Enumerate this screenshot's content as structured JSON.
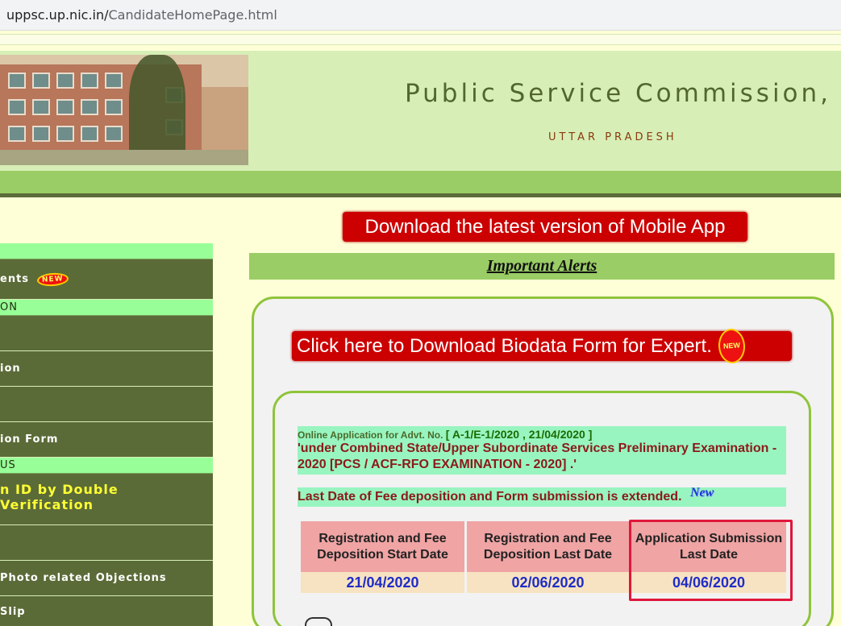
{
  "browser": {
    "url_host": "uppsc.up.nic.in/",
    "url_path": "CandidateHomePage.html"
  },
  "header": {
    "title": "Public Service Commission,",
    "subtitle": "UTTAR PRADESH"
  },
  "nav": {
    "items": [
      {
        "type": "header",
        "label": ""
      },
      {
        "type": "item",
        "label": "ents",
        "badge": "NEW"
      },
      {
        "type": "header",
        "label": "ON"
      },
      {
        "type": "item",
        "label": ""
      },
      {
        "type": "item",
        "label": "ion"
      },
      {
        "type": "item",
        "label": ""
      },
      {
        "type": "item",
        "label": "ion Form"
      },
      {
        "type": "header",
        "label": "US"
      },
      {
        "type": "item",
        "label": "n ID by Double Verification",
        "highlight": true
      },
      {
        "type": "item",
        "label": ""
      },
      {
        "type": "item",
        "label": "Photo related Objections"
      },
      {
        "type": "item",
        "label": "Slip"
      }
    ]
  },
  "banners": {
    "mobile_app": "Download the latest version of Mobile App",
    "important_alerts": "Important Alerts",
    "biodata": "Click here to Download Biodata Form for Expert.",
    "new_badge": "NEW"
  },
  "notice": {
    "prefix": "Online Application for Advt. No.",
    "advt": "[ A-1/E-1/2020 , 21/04/2020 ]",
    "description": "'under Combined State/Upper Subordinate Services Preliminary Examination - 2020 [PCS / ACF-RFO EXAMINATION - 2020] .'",
    "extension": "Last Date of Fee deposition and Form submission is extended.",
    "new_tag": "New"
  },
  "dates_table": {
    "headers": [
      "Registration and Fee Deposition Start Date",
      "Registration and Fee Deposition Last Date",
      "Application Submission Last Date"
    ],
    "values": [
      "21/04/2020",
      "02/06/2020",
      "04/06/2020"
    ]
  },
  "colors": {
    "header_bg": "#d7efb6",
    "nav_bg": "#5b6b38",
    "banner_red": "#cc0000",
    "accent_green": "#9acd65",
    "highlight_box": "#e0163b"
  }
}
